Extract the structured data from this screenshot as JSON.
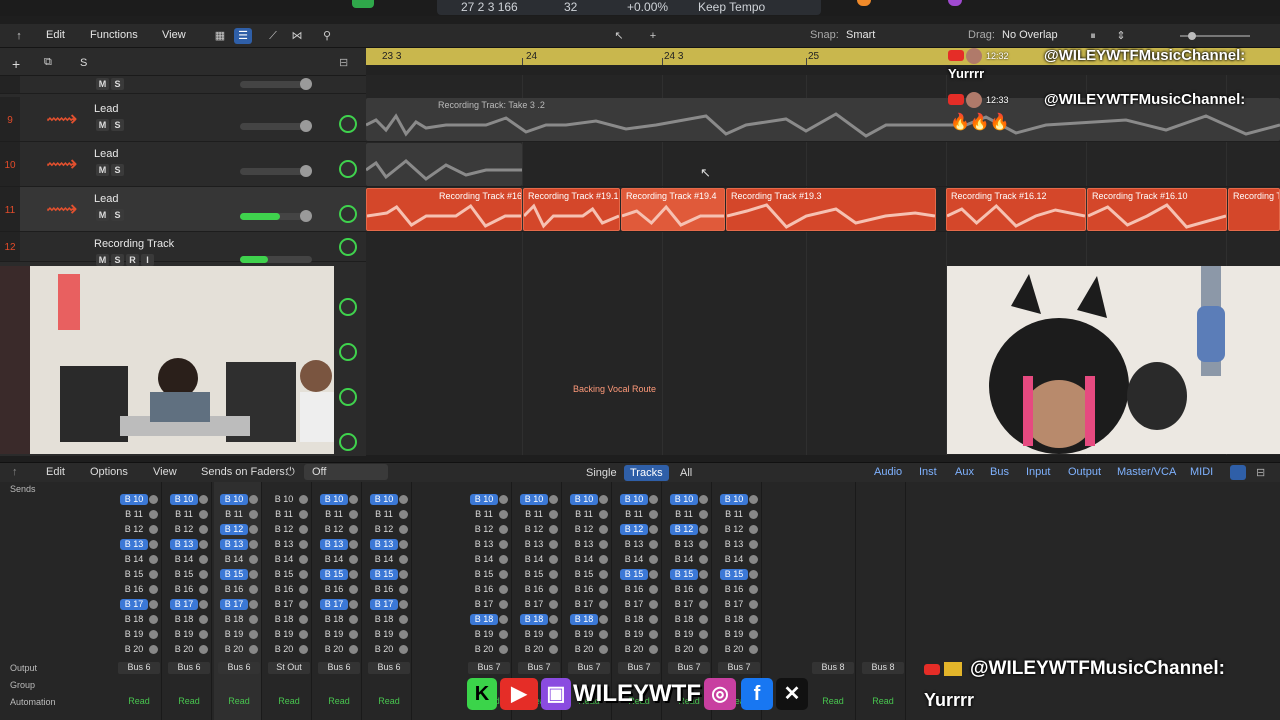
{
  "transport": {
    "position": "27 2 3 166",
    "beat": "32",
    "percent": "+0.00%",
    "tempo_mode": "Keep Tempo"
  },
  "arrange_toolbar": {
    "edit": "Edit",
    "functions": "Functions",
    "view": "View",
    "snap_label": "Snap:",
    "snap_value": "Smart",
    "drag_label": "Drag:",
    "drag_value": "No Overlap"
  },
  "track_header": {
    "add": "+",
    "s": "S"
  },
  "tracks": [
    {
      "num": "9",
      "name": "Lead",
      "m": "M",
      "s": "S"
    },
    {
      "num": "10",
      "name": "Lead",
      "m": "M",
      "s": "S"
    },
    {
      "num": "11",
      "name": "Lead",
      "m": "M",
      "s": "S"
    },
    {
      "num": "12",
      "name": "Recording Track",
      "m": "M",
      "s": "S",
      "r": "R",
      "i": "I"
    }
  ],
  "ruler": {
    "labels": [
      "23 3",
      "24",
      "24 3",
      "25"
    ]
  },
  "regions": {
    "take": "Recording Track: Take 3 .2",
    "r1": "Recording Track #16.",
    "r2": "Recording Track #19.1",
    "r3": "Recording Track #19.4",
    "r4": "Recording Track #19.3",
    "r5": "Recording Track #16.12",
    "r6": "Recording Track #16.10",
    "r7": "Recording T"
  },
  "backing_label": "Backing Vocal Route",
  "chat": {
    "msg1_time": "12:32",
    "msg1_user": "@WILEYWTFMusicChannel:",
    "msg1_text": "Yurrrr",
    "msg2_time": "12:33",
    "msg2_user": "@WILEYWTFMusicChannel:",
    "msg3_user": "@WILEYWTFMusicChannel:",
    "msg3_text": "Yurrrr"
  },
  "mixer_toolbar": {
    "edit": "Edit",
    "options": "Options",
    "view": "View",
    "sends_on_faders": "Sends on Faders:",
    "sends_value": "Off",
    "single": "Single",
    "tracks": "Tracks",
    "all": "All",
    "filters": [
      "Audio",
      "Inst",
      "Aux",
      "Bus",
      "Input",
      "Output",
      "Master/VCA",
      "MIDI"
    ]
  },
  "mixer": {
    "row_labels": {
      "sends": "Sends",
      "output": "Output",
      "group": "Group",
      "automation": "Automation"
    },
    "send_names": [
      "B 10",
      "B 11",
      "B 12",
      "B 13",
      "B 14",
      "B 15",
      "B 16",
      "B 17",
      "B 18",
      "B 19",
      "B 20"
    ],
    "outputs": [
      "Bus 6",
      "Bus 6",
      "Bus 6",
      "St Out",
      "Bus 6",
      "Bus 6",
      "Bus 7",
      "Bus 7",
      "Bus 7",
      "Bus 7",
      "Bus 7",
      "Bus 7",
      "Bus 8",
      "Bus 8"
    ],
    "automation": "Read"
  },
  "social": {
    "brand": "WILEYWTF"
  }
}
